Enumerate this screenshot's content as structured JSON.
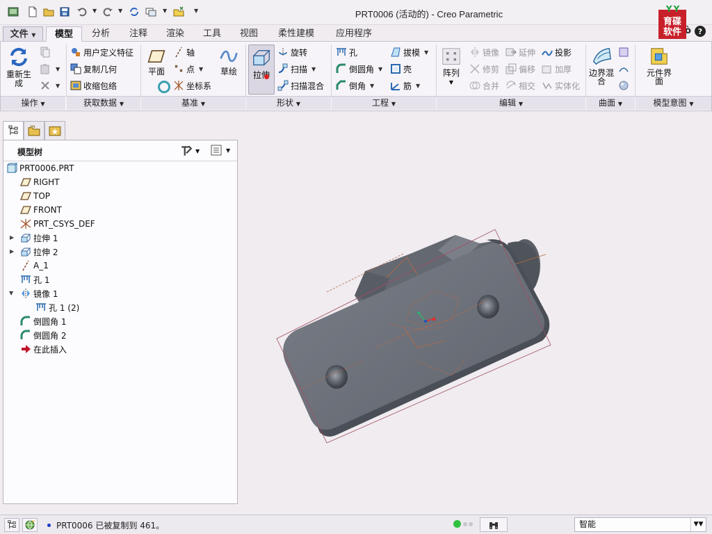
{
  "window": {
    "title": "PRT0006 (活动的) - Creo Parametric"
  },
  "logo": {
    "line1": "育碟",
    "line2": "软件"
  },
  "menu_tabs": [
    "文件",
    "模型",
    "分析",
    "注释",
    "渲染",
    "工具",
    "视图",
    "柔性建模",
    "应用程序"
  ],
  "ribbon": {
    "operations": {
      "label": "操作",
      "regenerate": "重新生成"
    },
    "get_data": {
      "label": "获取数据",
      "udf": "用户定义特征",
      "copy_geometry": "复制几何",
      "shrinkwrap": "收缩包络"
    },
    "datum": {
      "label": "基准",
      "plane": "平面",
      "axis": "轴",
      "point": "点",
      "csys": "坐标系",
      "sketch": "草绘"
    },
    "shapes": {
      "label": "形状",
      "extrude": "拉伸",
      "revolve": "旋转",
      "sweep": "扫描",
      "swept_blend": "扫描混合"
    },
    "engineering": {
      "label": "工程",
      "hole": "孔",
      "round": "倒圆角",
      "chamfer": "倒角",
      "draft": "拔模",
      "shell": "壳",
      "rib": "筋"
    },
    "editing": {
      "label": "编辑",
      "pattern": "阵列",
      "mirror": "镜像",
      "trim": "修剪",
      "merge": "合并",
      "extend": "延伸",
      "offset": "偏移",
      "intersect": "相交",
      "project": "投影",
      "thicken": "加厚",
      "solidify": "实体化"
    },
    "surfaces": {
      "label": "曲面",
      "boundary_blend": "边界混合"
    },
    "model_intent": {
      "label": "模型意图",
      "component_interface": "元件界面"
    }
  },
  "model_tree": {
    "title": "模型树",
    "items": [
      {
        "label": "PRT0006.PRT",
        "icon": "part-icon"
      },
      {
        "label": "RIGHT",
        "icon": "datum-plane-icon"
      },
      {
        "label": "TOP",
        "icon": "datum-plane-icon"
      },
      {
        "label": "FRONT",
        "icon": "datum-plane-icon"
      },
      {
        "label": "PRT_CSYS_DEF",
        "icon": "csys-icon"
      },
      {
        "label": "拉伸 1",
        "icon": "extrude-icon"
      },
      {
        "label": "拉伸 2",
        "icon": "extrude-icon"
      },
      {
        "label": "A_1",
        "icon": "axis-icon"
      },
      {
        "label": "孔 1",
        "icon": "hole-icon"
      },
      {
        "label": "镜像 1",
        "icon": "mirror-icon"
      },
      {
        "label": "孔 1 (2)",
        "icon": "hole-icon"
      },
      {
        "label": "倒圆角 1",
        "icon": "round-icon"
      },
      {
        "label": "倒圆角 2",
        "icon": "round-icon"
      },
      {
        "label": "在此插入",
        "icon": "insert-here-icon"
      }
    ]
  },
  "status": {
    "message": "PRT0006 已被复制到 461。",
    "filter": "智能"
  },
  "colors": {
    "model": "#6f737c",
    "insert_arrow": "#c0152a",
    "datum": "#b86a4a"
  }
}
